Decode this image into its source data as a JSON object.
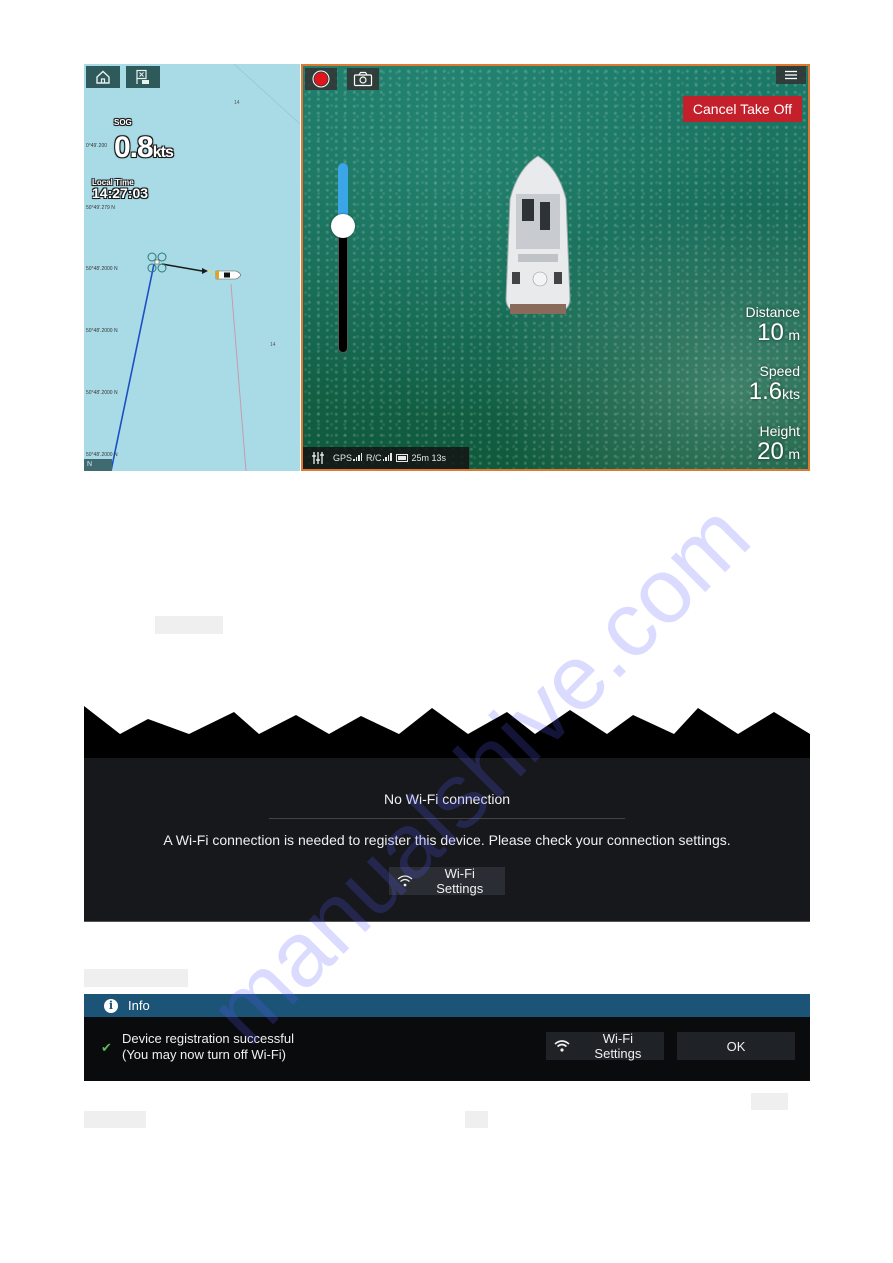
{
  "screen1": {
    "chart": {
      "home_button": "home-icon",
      "waypoint_button": "cancel-waypoint-icon",
      "sog_label": "SOG",
      "sog_value": "0.8",
      "sog_unit": "kts",
      "local_time_label": "Local Time",
      "local_time_value": "14:27:03",
      "orientation": "N",
      "latlon_labels": [
        "0°49'.200",
        "50°49'.279 N",
        "50°48'.2000 N",
        "50°48'.2000 N",
        "50°48'.2000 N",
        "50°48'.2000 N"
      ]
    },
    "video": {
      "record_icon": "record-icon",
      "camera_icon": "camera-icon",
      "menu_icon": "menu-icon",
      "cancel_takeoff_label": "Cancel Take Off",
      "height_slider_level": 0.67,
      "readouts": [
        {
          "label": "Distance",
          "value": "10",
          "unit": "m"
        },
        {
          "label": "Speed",
          "value": "1.6",
          "unit": "kts"
        },
        {
          "label": "Height",
          "value": "20",
          "unit": "m"
        }
      ],
      "status": {
        "gps_label": "GPS",
        "rc_label": "R/C",
        "flight_time": "25m 13s"
      }
    }
  },
  "screen2": {
    "title": "No Wi-Fi connection",
    "message": "A Wi-Fi connection is needed to register this device. Please check your connection settings.",
    "wifi_button_label": "Wi-Fi Settings"
  },
  "screen3": {
    "header_title": "Info",
    "message_line1": "Device registration successful",
    "message_line2": "(You may now turn off Wi-Fi)",
    "wifi_button_label": "Wi-Fi Settings",
    "ok_button_label": "OK"
  },
  "watermark": "manualshive.com",
  "colors": {
    "chart_sea": "#a9dbe6",
    "video_border": "#e07830",
    "cancel_button": "#c3202c",
    "slider_fill": "#3aa6e8",
    "info_header": "#1c5477",
    "success_check": "#5cb85c"
  }
}
